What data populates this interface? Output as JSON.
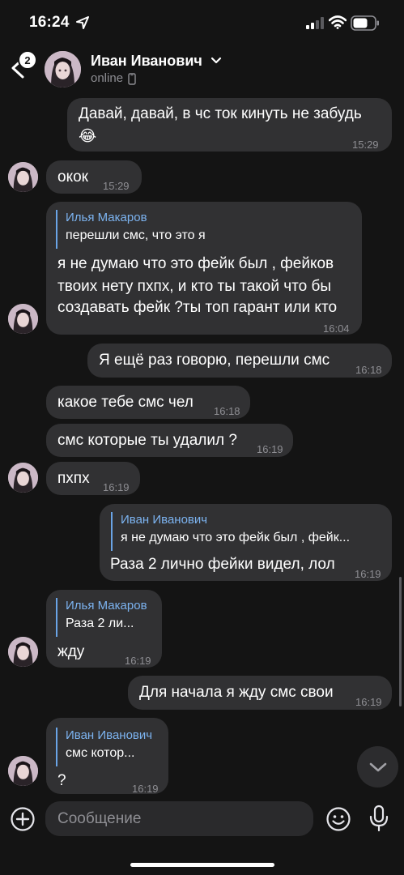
{
  "status_bar": {
    "time": "16:24"
  },
  "header": {
    "back_badge": "2",
    "contact_name": "Иван Иванович",
    "contact_status": "online"
  },
  "messages": [
    {
      "side": "out",
      "text_lines": [
        "Давай, давай, в чс ток кинуть не забудь",
        "😂"
      ],
      "time": "15:29"
    },
    {
      "side": "in",
      "text": "окок",
      "time": "15:29"
    },
    {
      "side": "in",
      "reply_name": "Илья Макаров",
      "reply_text": "перешли смс, что это я",
      "text_lines": [
        "я не думаю что это фейк был , фейков",
        "твоих нету пхпх, и кто ты такой что бы",
        "создавать фейк ?ты топ гарант или кто"
      ],
      "time": "16:04"
    },
    {
      "side": "out",
      "text": "Я ещё раз говорю, перешли смс",
      "time": "16:18"
    },
    {
      "side": "in",
      "text": "какое тебе смс чел",
      "time": "16:18"
    },
    {
      "side": "in",
      "text": "смс которые ты удалил ?",
      "time": "16:19"
    },
    {
      "side": "in",
      "text": "пхпх",
      "time": "16:19"
    },
    {
      "side": "out",
      "reply_name": "Иван Иванович",
      "reply_text": "я не думаю что это фейк был , фейк...",
      "text": "Раза 2 лично фейки видел, лол",
      "time": "16:19"
    },
    {
      "side": "in",
      "reply_name": "Илья Макаров",
      "reply_text": "Раза 2 ли...",
      "text": "жду",
      "time": "16:19"
    },
    {
      "side": "out",
      "text": "Для начала я жду смс свои",
      "time": "16:19"
    },
    {
      "side": "in",
      "reply_name": "Иван Иванович",
      "reply_text": "смс котор...",
      "text": "?",
      "time": "16:19"
    }
  ],
  "composer": {
    "placeholder": "Сообщение"
  },
  "colors": {
    "background": "#141414",
    "bubble": "#313133",
    "reply_accent": "#7cb3f0",
    "timestamp": "#8e8e93"
  },
  "icons": [
    "location-arrow-icon",
    "signal-icon",
    "wifi-icon",
    "battery-icon",
    "back-chevron-icon",
    "chevron-down-icon",
    "phone-icon",
    "chevron-down-icon",
    "plus-icon",
    "emoji-icon",
    "microphone-icon"
  ]
}
